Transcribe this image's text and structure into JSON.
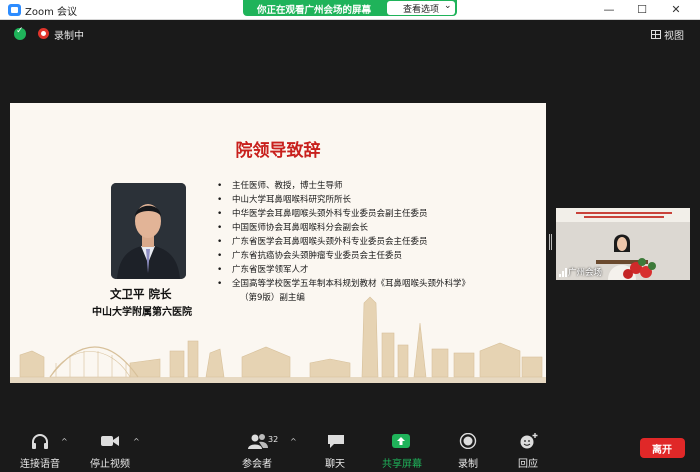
{
  "window": {
    "title": "Zoom 会议"
  },
  "banner": {
    "text": "你正在观看广州会场的屏幕",
    "options_label": "查看选项",
    "options_chevron": "⌄"
  },
  "window_controls": {
    "minimize": "—",
    "maximize": "☐",
    "close": "✕"
  },
  "status": {
    "recording_label": "录制中",
    "view_label": "视图"
  },
  "slide": {
    "title": "院领导致辞",
    "speaker_name": "文卫平  院长",
    "speaker_org": "中山大学附属第六医院",
    "bullets": [
      "主任医师、教授，博士生导师",
      "中山大学耳鼻咽喉科研究所所长",
      "中华医学会耳鼻咽喉头颈外科专业委员会副主任委员",
      "中国医师协会耳鼻咽喉科分会副会长",
      "广东省医学会耳鼻咽喉头颈外科专业委员会主任委员",
      "广东省抗癌协会头颈肿瘤专业委员会主任委员",
      "广东省医学领军人才",
      "全国高等学校医学五年制本科规划教材《耳鼻咽喉头颈外科学》",
      "（第9版）副主编"
    ]
  },
  "thumbnail": {
    "label": "广州会场"
  },
  "toolbar": {
    "audio_label": "连接语音",
    "video_label": "停止视频",
    "participants_label": "参会者",
    "participants_count": "32",
    "chat_label": "聊天",
    "share_label": "共享屏幕",
    "record_label": "录制",
    "reactions_label": "回应",
    "leave_label": "离开",
    "caret": "^"
  },
  "colors": {
    "share_green": "#1fb35a",
    "leave_red": "#e02828",
    "title_red": "#c8201d"
  }
}
